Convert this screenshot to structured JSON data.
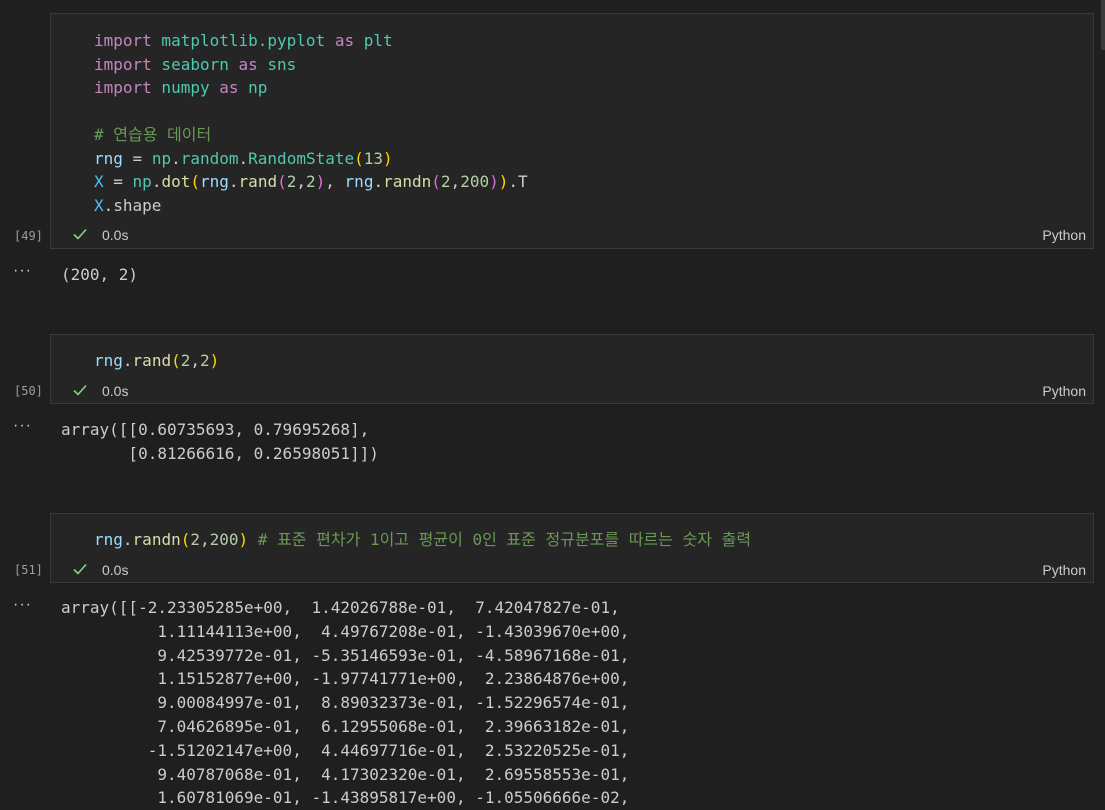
{
  "cells": [
    {
      "exec_count": "[49]",
      "duration": "0.0s",
      "language": "Python",
      "code_lines": [
        [
          {
            "t": "import",
            "c": "kw"
          },
          {
            "t": " matplotlib.",
            "c": "mod"
          },
          {
            "t": "pyplot",
            "c": "mod"
          },
          {
            "t": " as ",
            "c": "kw"
          },
          {
            "t": "plt",
            "c": "mod"
          }
        ],
        [
          {
            "t": "import",
            "c": "kw"
          },
          {
            "t": " seaborn",
            "c": "mod"
          },
          {
            "t": " as ",
            "c": "kw"
          },
          {
            "t": "sns",
            "c": "mod"
          }
        ],
        [
          {
            "t": "import",
            "c": "kw"
          },
          {
            "t": " numpy",
            "c": "mod"
          },
          {
            "t": " as ",
            "c": "kw"
          },
          {
            "t": "np",
            "c": "mod"
          }
        ],
        [],
        [
          {
            "t": "# 연습용 데이터",
            "c": "cm"
          }
        ],
        [
          {
            "t": "rng",
            "c": "var"
          },
          {
            "t": " = ",
            "c": "pl"
          },
          {
            "t": "np",
            "c": "mod"
          },
          {
            "t": ".",
            "c": "pl"
          },
          {
            "t": "random",
            "c": "mod"
          },
          {
            "t": ".",
            "c": "pl"
          },
          {
            "t": "RandomState",
            "c": "mod"
          },
          {
            "t": "(",
            "c": "p1"
          },
          {
            "t": "13",
            "c": "num"
          },
          {
            "t": ")",
            "c": "p1"
          }
        ],
        [
          {
            "t": "X",
            "c": "const"
          },
          {
            "t": " = ",
            "c": "pl"
          },
          {
            "t": "np",
            "c": "mod"
          },
          {
            "t": ".",
            "c": "pl"
          },
          {
            "t": "dot",
            "c": "fn"
          },
          {
            "t": "(",
            "c": "p1"
          },
          {
            "t": "rng",
            "c": "var"
          },
          {
            "t": ".",
            "c": "pl"
          },
          {
            "t": "rand",
            "c": "fn"
          },
          {
            "t": "(",
            "c": "p2"
          },
          {
            "t": "2",
            "c": "num"
          },
          {
            "t": ",",
            "c": "pl"
          },
          {
            "t": "2",
            "c": "num"
          },
          {
            "t": ")",
            "c": "p2"
          },
          {
            "t": ", ",
            "c": "pl"
          },
          {
            "t": "rng",
            "c": "var"
          },
          {
            "t": ".",
            "c": "pl"
          },
          {
            "t": "randn",
            "c": "fn"
          },
          {
            "t": "(",
            "c": "p2"
          },
          {
            "t": "2",
            "c": "num"
          },
          {
            "t": ",",
            "c": "pl"
          },
          {
            "t": "200",
            "c": "num"
          },
          {
            "t": ")",
            "c": "p2"
          },
          {
            "t": ")",
            "c": "p1"
          },
          {
            "t": ".T",
            "c": "pl"
          }
        ],
        [
          {
            "t": "X",
            "c": "const"
          },
          {
            "t": ".shape",
            "c": "pl"
          }
        ]
      ],
      "output": "(200, 2)"
    },
    {
      "exec_count": "[50]",
      "duration": "0.0s",
      "language": "Python",
      "code_lines": [
        [
          {
            "t": "rng",
            "c": "var"
          },
          {
            "t": ".",
            "c": "pl"
          },
          {
            "t": "rand",
            "c": "fn"
          },
          {
            "t": "(",
            "c": "p1"
          },
          {
            "t": "2",
            "c": "num"
          },
          {
            "t": ",",
            "c": "pl"
          },
          {
            "t": "2",
            "c": "num"
          },
          {
            "t": ")",
            "c": "p1"
          }
        ]
      ],
      "output": "array([[0.60735693, 0.79695268],\n       [0.81266616, 0.26598051]])"
    },
    {
      "exec_count": "[51]",
      "duration": "0.0s",
      "language": "Python",
      "code_lines": [
        [
          {
            "t": "rng",
            "c": "var"
          },
          {
            "t": ".",
            "c": "pl"
          },
          {
            "t": "randn",
            "c": "fn"
          },
          {
            "t": "(",
            "c": "p1"
          },
          {
            "t": "2",
            "c": "num"
          },
          {
            "t": ",",
            "c": "pl"
          },
          {
            "t": "200",
            "c": "num"
          },
          {
            "t": ")",
            "c": "p1"
          },
          {
            "t": " # 표준 편차가 1이고 평균이 0인 표준 정규분포를 따르는 숫자 출력",
            "c": "cm"
          }
        ]
      ],
      "output": "array([[-2.23305285e+00,  1.42026788e-01,  7.42047827e-01,\n          1.11144113e+00,  4.49767208e-01, -1.43039670e+00,\n          9.42539772e-01, -5.35146593e-01, -4.58967168e-01,\n          1.15152877e+00, -1.97741771e+00,  2.23864876e+00,\n          9.00084997e-01,  8.89032373e-01, -1.52296574e-01,\n          7.04626895e-01,  6.12955068e-01,  2.39663182e-01,\n         -1.51202147e+00,  4.44697716e-01,  2.53220525e-01,\n          9.40787068e-01,  4.17302320e-01,  2.69558553e-01,\n          1.60781069e-01, -1.43895817e+00, -1.05506666e-02,"
    }
  ],
  "more_icon": "···"
}
